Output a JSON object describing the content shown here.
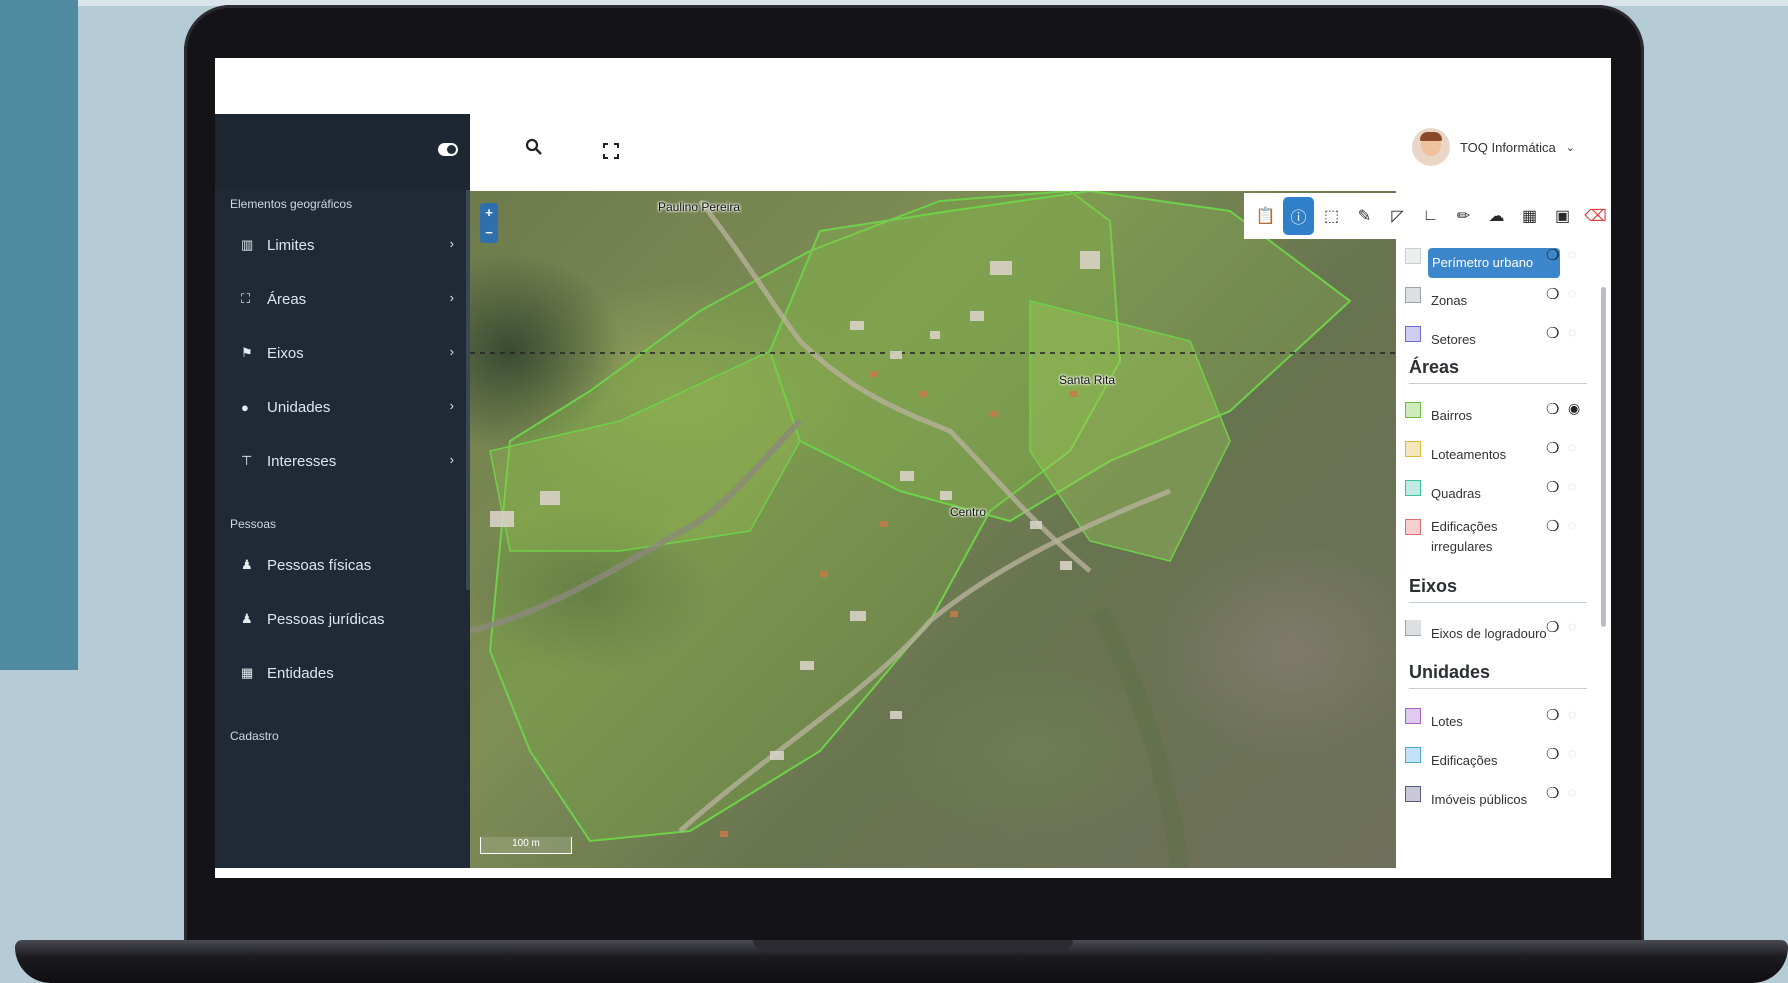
{
  "sidebar": {
    "sections": [
      {
        "title": "Elementos geográficos",
        "items": [
          {
            "label": "Limites",
            "icon": "map-icon"
          },
          {
            "label": "Áreas",
            "icon": "map-marked-icon"
          },
          {
            "label": "Eixos",
            "icon": "signpost-icon"
          },
          {
            "label": "Unidades",
            "icon": "location-pin-icon"
          },
          {
            "label": "Interesses",
            "icon": "thumbtack-icon"
          }
        ]
      },
      {
        "title": "Pessoas",
        "items": [
          {
            "label": "Pessoas físicas",
            "icon": "user-icon"
          },
          {
            "label": "Pessoas jurídicas",
            "icon": "user-tie-icon"
          },
          {
            "label": "Entidades",
            "icon": "building-icon"
          }
        ]
      },
      {
        "title": "Cadastro",
        "items": []
      }
    ]
  },
  "header": {
    "user_name": "TOQ Informática"
  },
  "map": {
    "labels": [
      "Paulino Pereira",
      "Santa Rita",
      "Centro"
    ],
    "scale": "100 m",
    "zoom_in": "+",
    "zoom_out": "−"
  },
  "toolbar": {
    "tools": [
      "clipboard-icon",
      "info-icon",
      "select-area-icon",
      "edit-shape-icon",
      "draw-polygon-icon",
      "measure-icon",
      "pencil-icon",
      "cloud-upload-icon",
      "film-icon",
      "image-icon",
      "eraser-icon"
    ],
    "active": "info-icon"
  },
  "layers": {
    "top_items": [
      {
        "name": "Perímetro urbano",
        "color": "#c8ccd0",
        "visible": false,
        "highlight": true
      },
      {
        "name": "Zonas",
        "color": "#9aa3aa",
        "visible": false
      },
      {
        "name": "Setores",
        "color": "#6e6ad6",
        "visible": false
      }
    ],
    "groups": [
      {
        "title": "Áreas",
        "items": [
          {
            "name": "Bairros",
            "color": "#6bbf3c",
            "visible": true
          },
          {
            "name": "Loteamentos",
            "color": "#e0b53a",
            "visible": false
          },
          {
            "name": "Quadras",
            "color": "#3fbfa8",
            "visible": false
          },
          {
            "name": "Edificações irregulares",
            "color": "#e07070",
            "visible": false
          }
        ]
      },
      {
        "title": "Eixos",
        "items": [
          {
            "name": "Eixos de logradouro",
            "color": "#9aa3aa",
            "visible": false
          }
        ]
      },
      {
        "title": "Unidades",
        "items": [
          {
            "name": "Lotes",
            "color": "#a45fcf",
            "visible": false
          },
          {
            "name": "Edificações",
            "color": "#4fa7e0",
            "visible": false
          },
          {
            "name": "Imóveis públicos",
            "color": "#5a5a86",
            "visible": false
          }
        ]
      }
    ]
  }
}
